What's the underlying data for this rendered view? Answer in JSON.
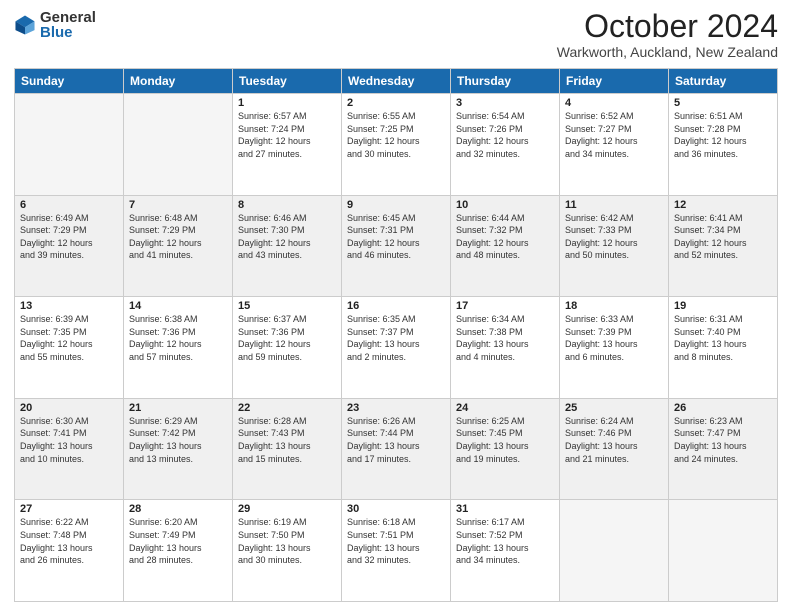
{
  "logo": {
    "general": "General",
    "blue": "Blue"
  },
  "header": {
    "title": "October 2024",
    "location": "Warkworth, Auckland, New Zealand"
  },
  "weekdays": [
    "Sunday",
    "Monday",
    "Tuesday",
    "Wednesday",
    "Thursday",
    "Friday",
    "Saturday"
  ],
  "weeks": [
    [
      {
        "day": "",
        "info": ""
      },
      {
        "day": "",
        "info": ""
      },
      {
        "day": "1",
        "info": "Sunrise: 6:57 AM\nSunset: 7:24 PM\nDaylight: 12 hours\nand 27 minutes."
      },
      {
        "day": "2",
        "info": "Sunrise: 6:55 AM\nSunset: 7:25 PM\nDaylight: 12 hours\nand 30 minutes."
      },
      {
        "day": "3",
        "info": "Sunrise: 6:54 AM\nSunset: 7:26 PM\nDaylight: 12 hours\nand 32 minutes."
      },
      {
        "day": "4",
        "info": "Sunrise: 6:52 AM\nSunset: 7:27 PM\nDaylight: 12 hours\nand 34 minutes."
      },
      {
        "day": "5",
        "info": "Sunrise: 6:51 AM\nSunset: 7:28 PM\nDaylight: 12 hours\nand 36 minutes."
      }
    ],
    [
      {
        "day": "6",
        "info": "Sunrise: 6:49 AM\nSunset: 7:29 PM\nDaylight: 12 hours\nand 39 minutes."
      },
      {
        "day": "7",
        "info": "Sunrise: 6:48 AM\nSunset: 7:29 PM\nDaylight: 12 hours\nand 41 minutes."
      },
      {
        "day": "8",
        "info": "Sunrise: 6:46 AM\nSunset: 7:30 PM\nDaylight: 12 hours\nand 43 minutes."
      },
      {
        "day": "9",
        "info": "Sunrise: 6:45 AM\nSunset: 7:31 PM\nDaylight: 12 hours\nand 46 minutes."
      },
      {
        "day": "10",
        "info": "Sunrise: 6:44 AM\nSunset: 7:32 PM\nDaylight: 12 hours\nand 48 minutes."
      },
      {
        "day": "11",
        "info": "Sunrise: 6:42 AM\nSunset: 7:33 PM\nDaylight: 12 hours\nand 50 minutes."
      },
      {
        "day": "12",
        "info": "Sunrise: 6:41 AM\nSunset: 7:34 PM\nDaylight: 12 hours\nand 52 minutes."
      }
    ],
    [
      {
        "day": "13",
        "info": "Sunrise: 6:39 AM\nSunset: 7:35 PM\nDaylight: 12 hours\nand 55 minutes."
      },
      {
        "day": "14",
        "info": "Sunrise: 6:38 AM\nSunset: 7:36 PM\nDaylight: 12 hours\nand 57 minutes."
      },
      {
        "day": "15",
        "info": "Sunrise: 6:37 AM\nSunset: 7:36 PM\nDaylight: 12 hours\nand 59 minutes."
      },
      {
        "day": "16",
        "info": "Sunrise: 6:35 AM\nSunset: 7:37 PM\nDaylight: 13 hours\nand 2 minutes."
      },
      {
        "day": "17",
        "info": "Sunrise: 6:34 AM\nSunset: 7:38 PM\nDaylight: 13 hours\nand 4 minutes."
      },
      {
        "day": "18",
        "info": "Sunrise: 6:33 AM\nSunset: 7:39 PM\nDaylight: 13 hours\nand 6 minutes."
      },
      {
        "day": "19",
        "info": "Sunrise: 6:31 AM\nSunset: 7:40 PM\nDaylight: 13 hours\nand 8 minutes."
      }
    ],
    [
      {
        "day": "20",
        "info": "Sunrise: 6:30 AM\nSunset: 7:41 PM\nDaylight: 13 hours\nand 10 minutes."
      },
      {
        "day": "21",
        "info": "Sunrise: 6:29 AM\nSunset: 7:42 PM\nDaylight: 13 hours\nand 13 minutes."
      },
      {
        "day": "22",
        "info": "Sunrise: 6:28 AM\nSunset: 7:43 PM\nDaylight: 13 hours\nand 15 minutes."
      },
      {
        "day": "23",
        "info": "Sunrise: 6:26 AM\nSunset: 7:44 PM\nDaylight: 13 hours\nand 17 minutes."
      },
      {
        "day": "24",
        "info": "Sunrise: 6:25 AM\nSunset: 7:45 PM\nDaylight: 13 hours\nand 19 minutes."
      },
      {
        "day": "25",
        "info": "Sunrise: 6:24 AM\nSunset: 7:46 PM\nDaylight: 13 hours\nand 21 minutes."
      },
      {
        "day": "26",
        "info": "Sunrise: 6:23 AM\nSunset: 7:47 PM\nDaylight: 13 hours\nand 24 minutes."
      }
    ],
    [
      {
        "day": "27",
        "info": "Sunrise: 6:22 AM\nSunset: 7:48 PM\nDaylight: 13 hours\nand 26 minutes."
      },
      {
        "day": "28",
        "info": "Sunrise: 6:20 AM\nSunset: 7:49 PM\nDaylight: 13 hours\nand 28 minutes."
      },
      {
        "day": "29",
        "info": "Sunrise: 6:19 AM\nSunset: 7:50 PM\nDaylight: 13 hours\nand 30 minutes."
      },
      {
        "day": "30",
        "info": "Sunrise: 6:18 AM\nSunset: 7:51 PM\nDaylight: 13 hours\nand 32 minutes."
      },
      {
        "day": "31",
        "info": "Sunrise: 6:17 AM\nSunset: 7:52 PM\nDaylight: 13 hours\nand 34 minutes."
      },
      {
        "day": "",
        "info": ""
      },
      {
        "day": "",
        "info": ""
      }
    ]
  ]
}
